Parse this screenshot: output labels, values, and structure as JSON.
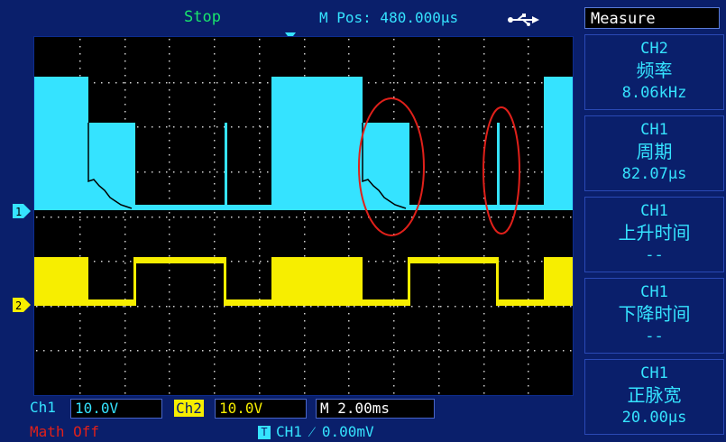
{
  "status": {
    "run_state": "Stop",
    "m_pos": "M Pos: 480.000µs"
  },
  "sidebar": {
    "title": "Measure",
    "panels": [
      {
        "channel": "CH2",
        "name": "频率",
        "value": "8.06kHz"
      },
      {
        "channel": "CH1",
        "name": "周期",
        "value": "82.07µs"
      },
      {
        "channel": "CH1",
        "name": "上升时间",
        "value": "--"
      },
      {
        "channel": "CH1",
        "name": "下降时间",
        "value": "--"
      },
      {
        "channel": "CH1",
        "name": "正脉宽",
        "value": "20.00µs"
      }
    ]
  },
  "bottom": {
    "ch1_label": "Ch1",
    "ch1_scale": "10.0V",
    "ch2_label": "Ch2",
    "ch2_scale": "10.0V",
    "timebase": "M 2.00ms",
    "math": "Math Off",
    "trigger": "CH1  ⁄  0.00mV",
    "trigger_icon": "T"
  },
  "markers": {
    "ch1": "1",
    "ch2": "2"
  },
  "colors": {
    "ch1": "#35e3ff",
    "ch2": "#f7ee00",
    "annotation": "#e0201a",
    "background": "#0a1f6b"
  },
  "icons": [
    "usb-icon",
    "trigger-position-icon",
    "ch1-ground-marker",
    "ch2-ground-marker"
  ]
}
